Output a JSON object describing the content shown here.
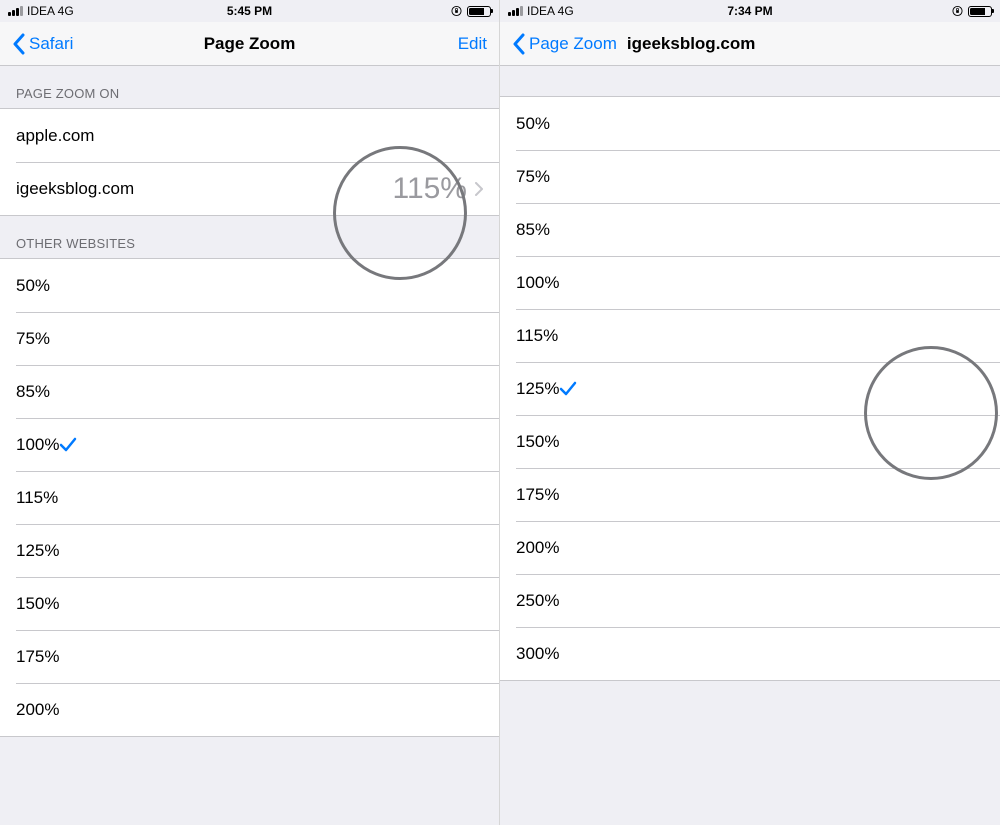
{
  "left": {
    "status": {
      "carrier": "IDEA 4G",
      "time": "5:45 PM"
    },
    "nav": {
      "back": "Safari",
      "title": "Page Zoom",
      "edit": "Edit"
    },
    "section_zoom_on": "PAGE ZOOM ON",
    "sites": [
      {
        "name": "apple.com",
        "value": ""
      },
      {
        "name": "igeeksblog.com",
        "value": "115%"
      }
    ],
    "section_other": "OTHER WEBSITES",
    "levels": [
      "50%",
      "75%",
      "85%",
      "100%",
      "115%",
      "125%",
      "150%",
      "175%",
      "200%"
    ],
    "selected": "100%"
  },
  "right": {
    "status": {
      "carrier": "IDEA 4G",
      "time": "7:34 PM"
    },
    "nav": {
      "back": "Page Zoom",
      "title": "igeeksblog.com"
    },
    "levels": [
      "50%",
      "75%",
      "85%",
      "100%",
      "115%",
      "125%",
      "150%",
      "175%",
      "200%",
      "250%",
      "300%"
    ],
    "selected": "125%"
  }
}
